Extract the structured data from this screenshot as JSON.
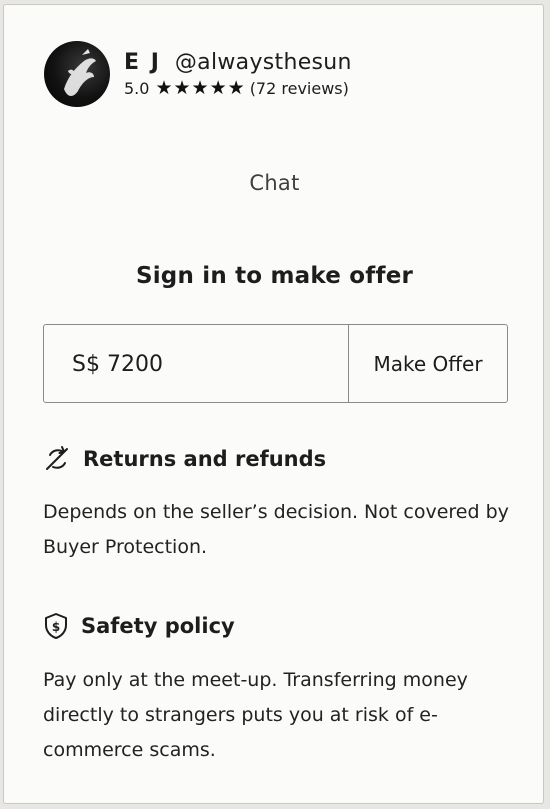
{
  "seller": {
    "initials": "E J",
    "username": "@alwaysthesun",
    "rating": "5.0",
    "stars": 5,
    "reviews": "(72 reviews)",
    "avatar_icon": "avatar-photo"
  },
  "chat_label": "Chat",
  "offer": {
    "heading": "Sign in to make offer",
    "value": "S$ 7200",
    "button_label": "Make Offer"
  },
  "returns": {
    "icon": "no-returns-icon",
    "title": "Returns and refunds",
    "body": "Depends on the seller’s decision. Not covered by Buyer Protection."
  },
  "safety": {
    "icon": "shield-dollar-icon",
    "title": "Safety policy",
    "body": "Pay only at the meet-up. Transferring money directly to strangers puts you at risk of e-commerce scams."
  },
  "colors": {
    "text": "#1d1d1d",
    "border": "#8c8a87",
    "card": "#fbfbfa"
  }
}
